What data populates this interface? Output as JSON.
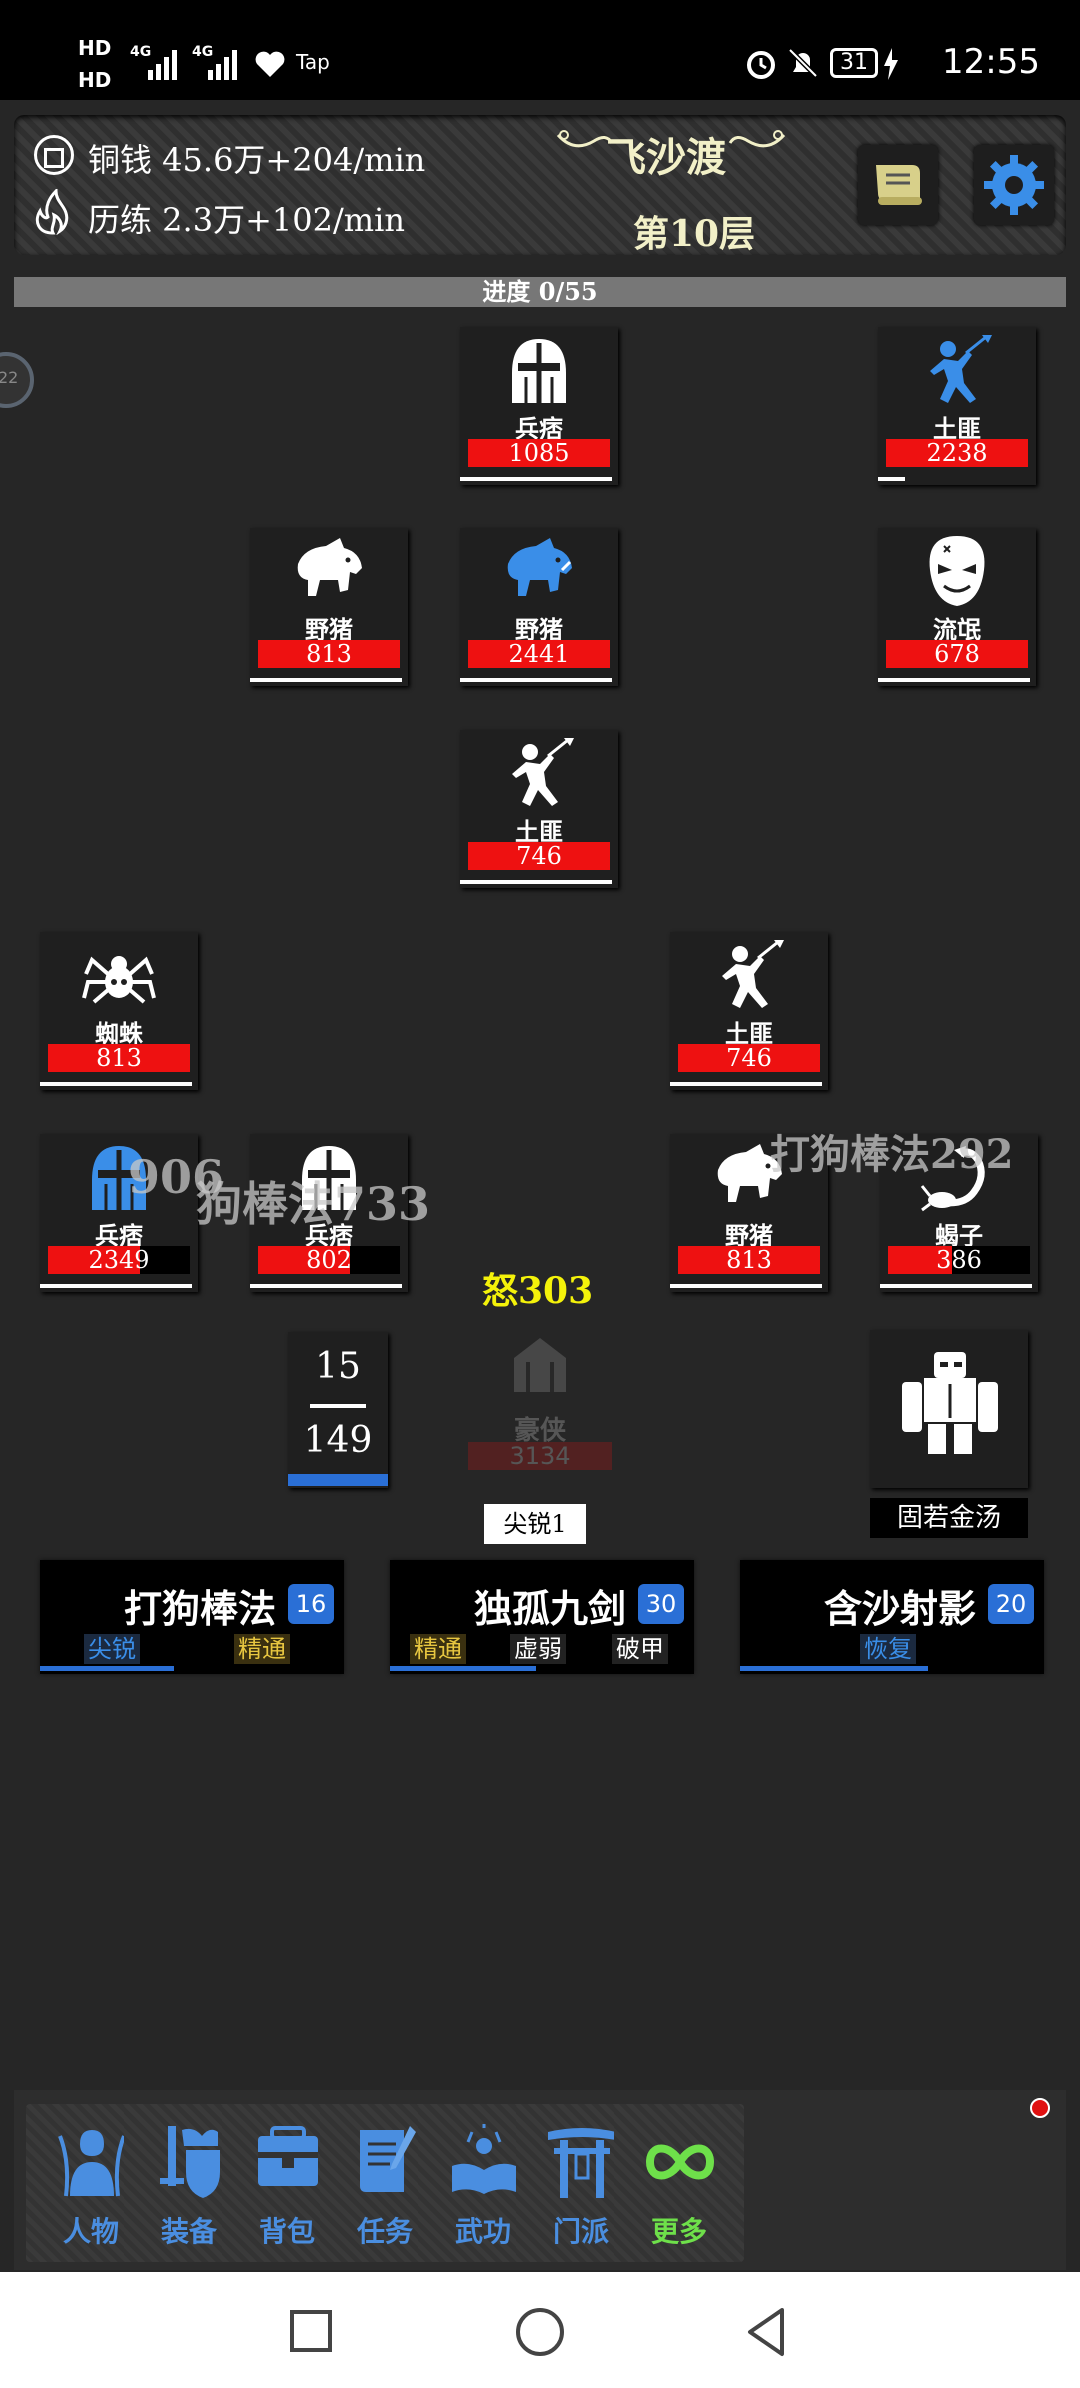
{
  "status_bar": {
    "hd1": "HD",
    "hd2": "HD",
    "net1": "4G",
    "net2": "4G",
    "app": "Tap",
    "battery": "31",
    "time": "12:55"
  },
  "header": {
    "copper": "铜钱  45.6万+204/min",
    "train": "历练  2.3万+102/min",
    "location": "飞沙渡",
    "floor": "第10层"
  },
  "progress": "进度 0/55",
  "side_badge": "22",
  "enemies": [
    {
      "name": "兵痞",
      "hp": "1085",
      "icon": "helmet-icon",
      "color": "#ffffff",
      "fill": 1.0,
      "under": 1.0
    },
    {
      "name": "土匪",
      "hp": "2238",
      "icon": "bandit-icon",
      "color": "#3a8ee8",
      "fill": 1.0,
      "under": 0.18
    },
    {
      "name": "野猪",
      "hp": "813",
      "icon": "boar-icon",
      "color": "#ffffff",
      "fill": 1.0,
      "under": 1.0
    },
    {
      "name": "野猪",
      "hp": "2441",
      "icon": "boar-icon",
      "color": "#3a8ee8",
      "fill": 1.0,
      "under": 1.0
    },
    {
      "name": "流氓",
      "hp": "678",
      "icon": "mask-icon",
      "color": "#ffffff",
      "fill": 1.0,
      "under": 1.0
    },
    {
      "name": "土匪",
      "hp": "746",
      "icon": "bandit-icon",
      "color": "#ffffff",
      "fill": 1.0,
      "under": 1.0
    },
    {
      "name": "蜘蛛",
      "hp": "813",
      "icon": "spider-icon",
      "color": "#ffffff",
      "fill": 1.0,
      "under": 1.0
    },
    {
      "name": "土匪",
      "hp": "746",
      "icon": "bandit-icon",
      "color": "#ffffff",
      "fill": 1.0,
      "under": 1.0
    },
    {
      "name": "兵痞",
      "hp": "2349",
      "icon": "helmet-icon",
      "color": "#3a8ee8",
      "fill": 0.65,
      "under": 1.0
    },
    {
      "name": "兵痞",
      "hp": "802",
      "icon": "helmet-icon",
      "color": "#ffffff",
      "fill": 0.65,
      "under": 1.0
    },
    {
      "name": "野猪",
      "hp": "813",
      "icon": "boar-icon",
      "color": "#ffffff",
      "fill": 1.0,
      "under": 1.0
    },
    {
      "name": "蝎子",
      "hp": "386",
      "icon": "scorpion-icon",
      "color": "#ffffff",
      "fill": 0.45,
      "under": 1.0
    }
  ],
  "floating": {
    "dmg_left": "906",
    "skill_left": "狗棒法733",
    "skill_right": "打狗棒法292",
    "rage": "怒303"
  },
  "player": {
    "combo_top": "15",
    "combo_bottom": "149",
    "name": "豪侠",
    "hp": "3134",
    "buff": "尖锐1",
    "ally": "固若金汤"
  },
  "skills": [
    {
      "name": "打狗棒法",
      "level": "16",
      "tags": [
        {
          "t": "尖锐",
          "c": "#3a8ee8",
          "bg": "#1b2a40"
        },
        {
          "t": "精通",
          "c": "#e7c640",
          "bg": "#3a3010"
        }
      ],
      "bar": 0.44
    },
    {
      "name": "独孤九剑",
      "level": "30",
      "tags": [
        {
          "t": "精通",
          "c": "#e7c640",
          "bg": "#3a3010"
        },
        {
          "t": "虚弱",
          "c": "#ffffff",
          "bg": "#222"
        },
        {
          "t": "破甲",
          "c": "#ffffff",
          "bg": "#222"
        }
      ],
      "bar": 0.48
    },
    {
      "name": "含沙射影",
      "level": "20",
      "tags": [
        {
          "t": "恢复",
          "c": "#3a8ee8",
          "bg": "#1b2a40"
        }
      ],
      "bar": 0.62
    }
  ],
  "nav": [
    {
      "label": "人物",
      "icon": "character-icon"
    },
    {
      "label": "装备",
      "icon": "equipment-icon"
    },
    {
      "label": "背包",
      "icon": "bag-icon"
    },
    {
      "label": "任务",
      "icon": "quest-icon"
    },
    {
      "label": "武功",
      "icon": "martial-icon"
    },
    {
      "label": "门派",
      "icon": "sect-icon"
    },
    {
      "label": "更多",
      "icon": "infinity-icon"
    }
  ],
  "colors": {
    "hp": "#ee1111",
    "accent": "#2a6fd6",
    "nav_label": "#4a8ee0",
    "more_green": "#6ee04a"
  }
}
